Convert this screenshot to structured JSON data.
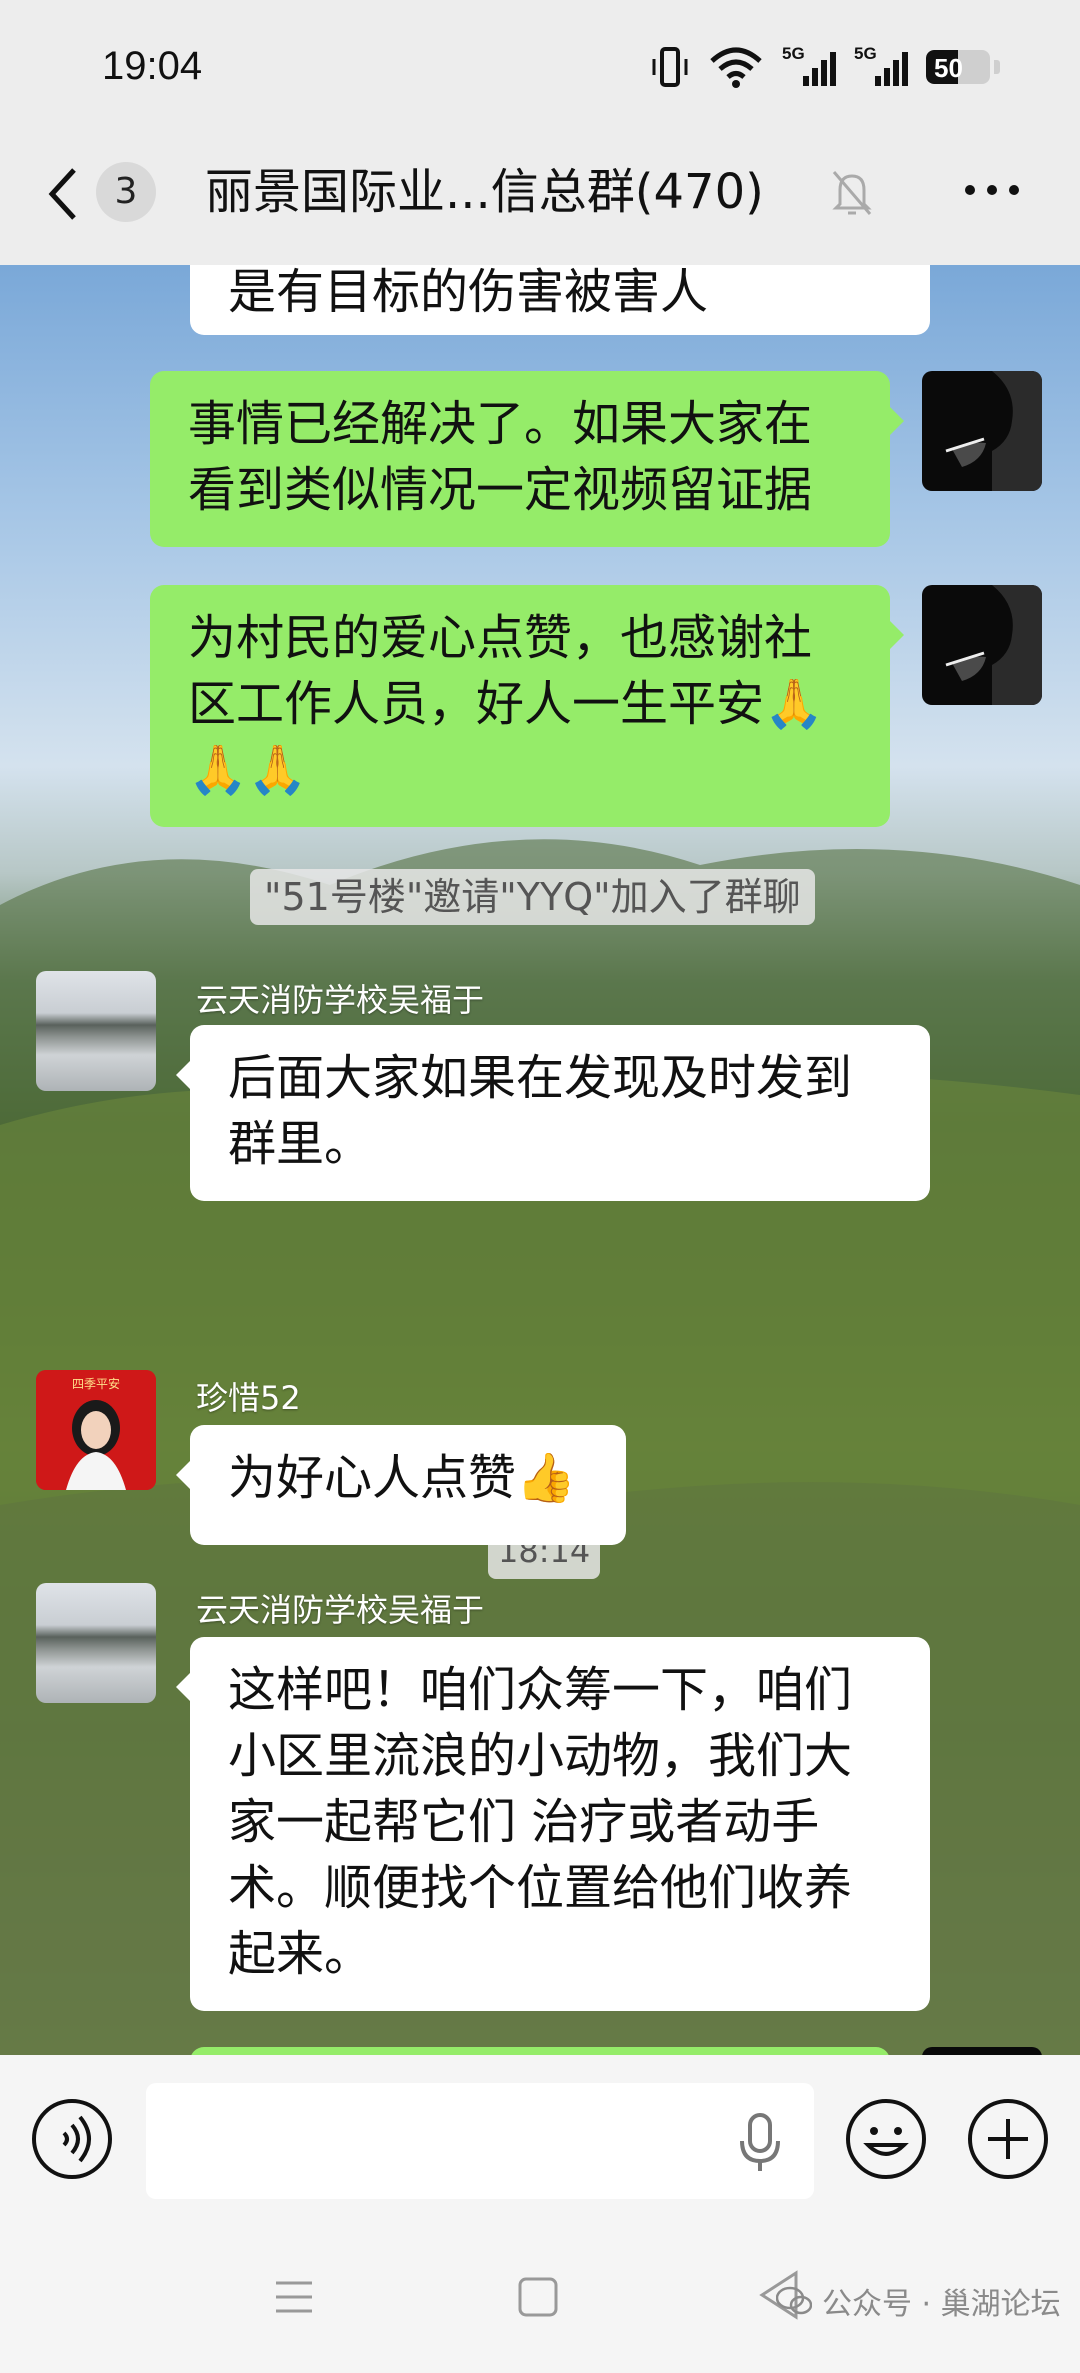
{
  "status_bar": {
    "time": "19:04",
    "signal1_label": "5G",
    "signal2_label": "5G",
    "battery_percent": 50,
    "icons": [
      "vibrate-icon",
      "wifi-icon",
      "signal-5g-icon",
      "signal-5g-icon",
      "battery-icon"
    ]
  },
  "nav": {
    "unread_count": "3",
    "title": "丽景国际业...信总群(470)",
    "icons": [
      "back-chevron-icon",
      "mute-bell-icon",
      "more-icon"
    ]
  },
  "messages": [
    {
      "type": "text",
      "side": "left",
      "text": "是有目标的伤害被害人"
    },
    {
      "type": "text",
      "side": "right",
      "text": "事情已经解决了。如果大家在看到类似情况一定视频留证据"
    },
    {
      "type": "text",
      "side": "right",
      "text": "为村民的爱心点赞，也感谢社区工作人员，好人一生平安🙏🙏🙏"
    },
    {
      "type": "system",
      "text": "\"51号楼\"邀请\"YYQ\"加入了群聊"
    },
    {
      "type": "text",
      "side": "left",
      "sender": "云天消防学校吴福于",
      "text": "后面大家如果在发现及时发到群里。"
    },
    {
      "type": "timestamp",
      "text": "18:14"
    },
    {
      "type": "text",
      "side": "left",
      "sender": "珍惜52",
      "text": "为好心人点赞👍"
    },
    {
      "type": "text",
      "side": "left",
      "sender": "云天消防学校吴福于",
      "text": "这样吧！咱们众筹一下，咱们小区里流浪的小动物，我们大家一起帮它们 治疗或者动手术。顺便找个位置给他们收养起来。"
    }
  ],
  "avatar_girl_caption": "四季平安",
  "input": {
    "placeholder": "",
    "value": ""
  },
  "watermark": "公众号 · 巢湖论坛",
  "colors": {
    "bubble_green": "#95ec69",
    "bubble_white": "#ffffff",
    "chrome_bg": "#ededed"
  }
}
